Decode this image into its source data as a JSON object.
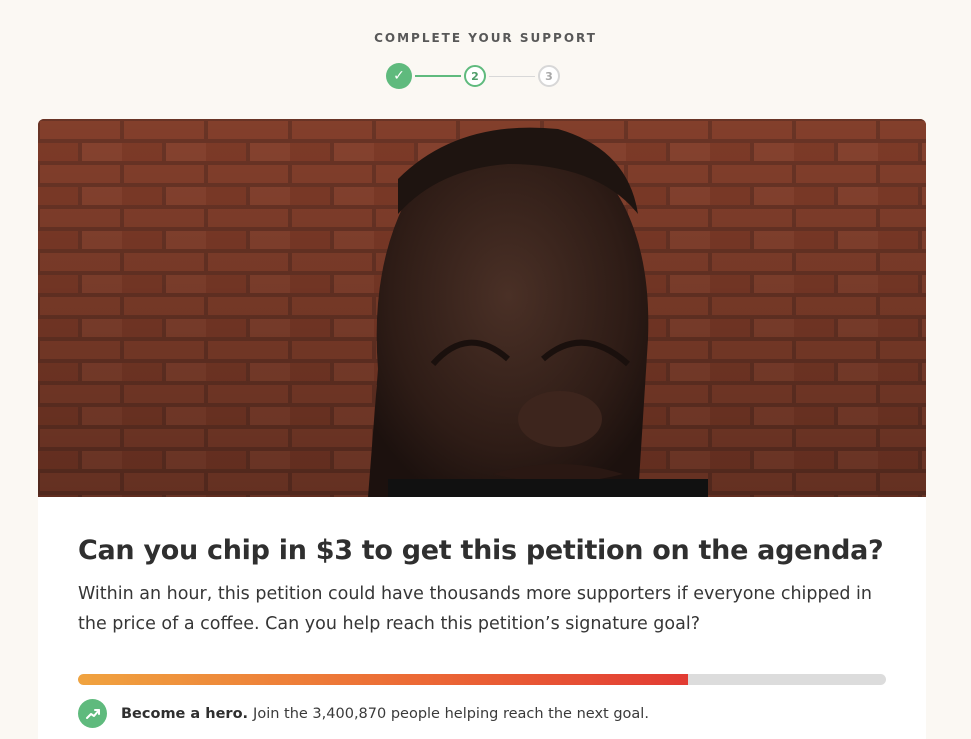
{
  "stepper": {
    "title": "COMPLETE YOUR SUPPORT",
    "steps": [
      {
        "label": "✓",
        "state": "done"
      },
      {
        "label": "2",
        "state": "active"
      },
      {
        "label": "3",
        "state": "pending"
      }
    ]
  },
  "card": {
    "image_icon": "portrait-photo",
    "headline": "Can you chip in $3 to get this petition on the agenda?",
    "body": "Within an hour, this petition could have thousands more supporters if everyone chipped in the price of a coffee. Can you help reach this petition’s signature goal?",
    "progress_fraction": 0.755,
    "hero_icon": "trending-up-icon",
    "hero_strong": "Become a hero.",
    "hero_text": "Join the 3,400,870 people helping reach the next goal."
  },
  "colors": {
    "accent_green": "#5fba7d",
    "progress_start": "#f0a33f",
    "progress_end": "#e23b33",
    "page_background": "#fbf8f3"
  }
}
